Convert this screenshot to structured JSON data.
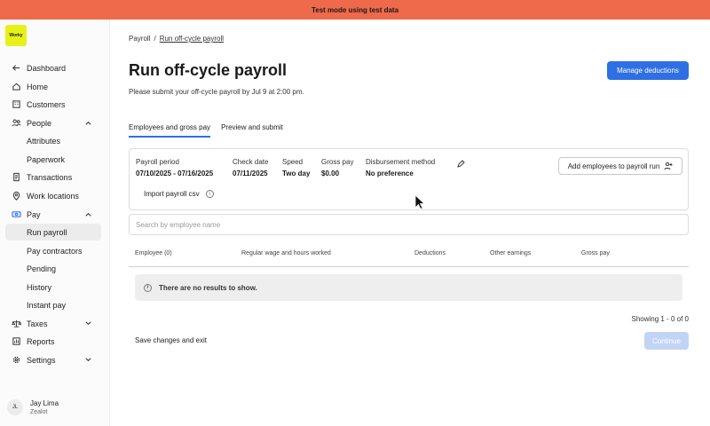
{
  "banner": {
    "text": "Test mode using test data"
  },
  "logo": {
    "text": "Worky"
  },
  "sidebar": {
    "items": [
      {
        "label": "Dashboard"
      },
      {
        "label": "Home"
      },
      {
        "label": "Customers"
      },
      {
        "label": "People"
      },
      {
        "label": "Attributes"
      },
      {
        "label": "Paperwork"
      },
      {
        "label": "Transactions"
      },
      {
        "label": "Work locations"
      },
      {
        "label": "Pay"
      },
      {
        "label": "Run payroll"
      },
      {
        "label": "Pay contractors"
      },
      {
        "label": "Pending"
      },
      {
        "label": "History"
      },
      {
        "label": "Instant pay"
      },
      {
        "label": "Taxes"
      },
      {
        "label": "Reports"
      },
      {
        "label": "Settings"
      }
    ]
  },
  "user": {
    "initials": "JL",
    "name": "Jay Lima",
    "role": "Zealot"
  },
  "breadcrumb": {
    "root": "Payroll",
    "sep": "/",
    "current": "Run off-cycle payroll"
  },
  "page": {
    "title": "Run off-cycle payroll",
    "subtitle": "Please submit your off-cycle payroll by Jul 9 at 2:00 pm.",
    "manage_button": "Manage deductions"
  },
  "tabs": [
    {
      "label": "Employees and gross pay"
    },
    {
      "label": "Preview and submit"
    }
  ],
  "period": {
    "payroll_period_label": "Payroll period",
    "payroll_period_value": "07/10/2025 - 07/16/2025",
    "check_date_label": "Check date",
    "check_date_value": "07/11/2025",
    "speed_label": "Speed",
    "speed_value": "Two day",
    "gross_pay_label": "Gross pay",
    "gross_pay_value": "$0.00",
    "disbursement_label": "Disbursement method",
    "disbursement_value": "No preference",
    "import_label": "Import payroll csv",
    "add_employees_button": "Add employees to payroll run"
  },
  "search": {
    "placeholder": "Search by employee name"
  },
  "table": {
    "headers": [
      "Employee (0)",
      "Regular wage and hours worked",
      "Deductions",
      "Other earnings",
      "Gross pay"
    ],
    "empty_message": "There are no results to show."
  },
  "footer": {
    "showing": "Showing 1 - 0 of 0",
    "save_exit": "Save changes and exit",
    "continue_button": "Continue"
  },
  "colors": {
    "banner": "#ee6a4a",
    "accent": "#2f6fe4",
    "logo": "#e6f11a"
  }
}
